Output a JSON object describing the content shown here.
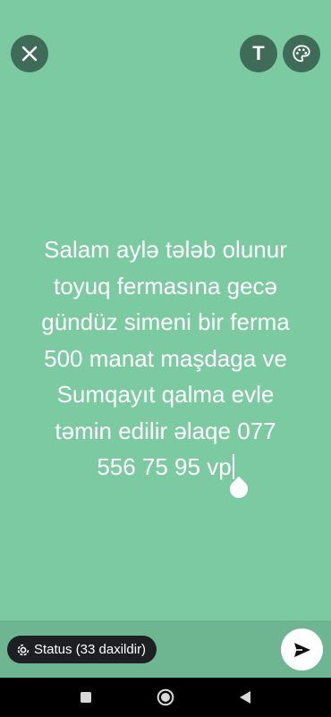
{
  "header": {
    "close_icon": "close-icon",
    "text_button_label": "T",
    "palette_icon": "palette-icon"
  },
  "composer": {
    "text": "Salam aylə tələb olunur\ntoyuq fermasına gecə\ngündüz simeni bir ferma\n500 manat maşdaga ve\nSumqayıt qalma evle\ntəmin edilir əlaqe 077\n556 75 95 vp",
    "background_color": "#7ccaa2",
    "text_color": "#ffffff"
  },
  "footer": {
    "audience_label": "Status (33 daxildir)",
    "audience_icon": "status-icon",
    "send_icon": "send-icon"
  },
  "system_nav": {
    "recents_icon": "recents-square-icon",
    "home_icon": "home-circle-icon",
    "back_icon": "back-triangle-icon"
  }
}
